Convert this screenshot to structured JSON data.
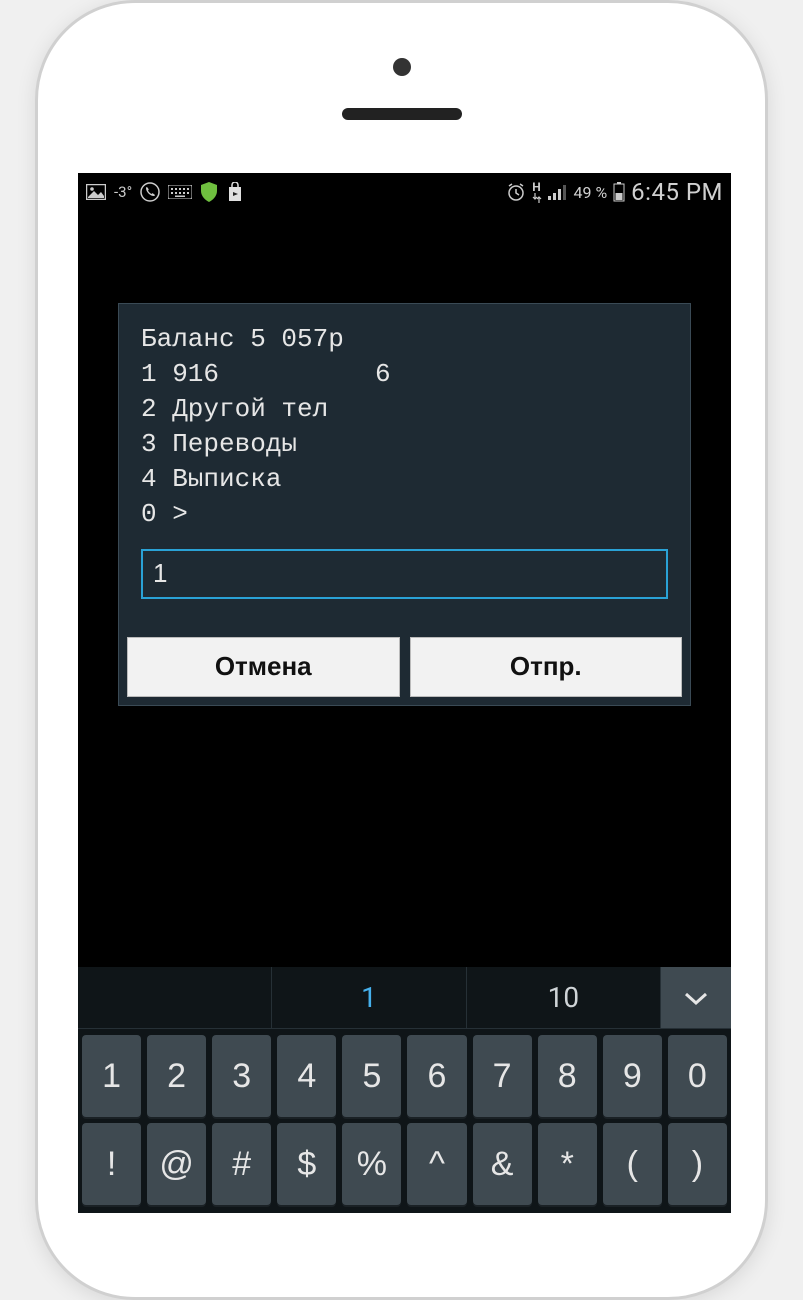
{
  "statusbar": {
    "temp": "-3°",
    "battery_pct": "49 %",
    "clock": "6:45 PM",
    "network_label": "H"
  },
  "dialog": {
    "lines": [
      "Баланс 5 057р",
      "1 916          6",
      "2 Другой тел",
      "3 Переводы",
      "4 Выписка",
      "0 >"
    ],
    "input_value": "1",
    "cancel_label": "Отмена",
    "send_label": "Отпр."
  },
  "keyboard": {
    "suggestions": [
      "",
      "1",
      "10"
    ],
    "active_suggestion_index": 1,
    "row1": [
      "1",
      "2",
      "3",
      "4",
      "5",
      "6",
      "7",
      "8",
      "9",
      "0"
    ],
    "row2": [
      "!",
      "@",
      "#",
      "$",
      "%",
      "^",
      "&",
      "*",
      "(",
      ")"
    ]
  }
}
